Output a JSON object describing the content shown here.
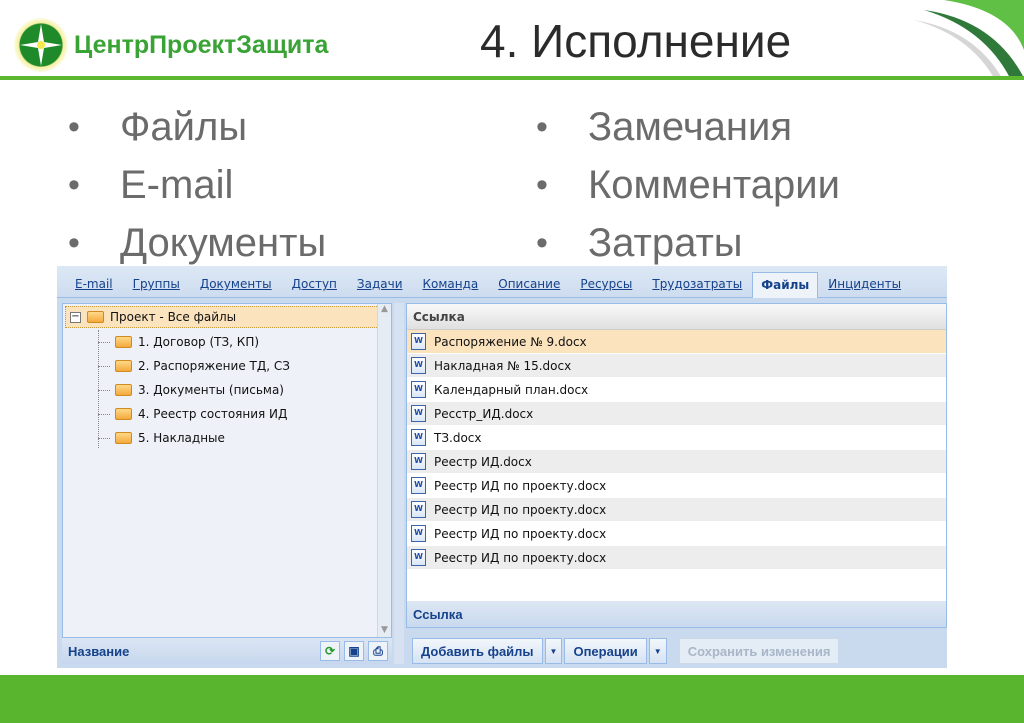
{
  "logo": {
    "text": "ЦентрПроектЗащита"
  },
  "title": "4. Исполнение",
  "bullets_left": [
    "Файлы",
    "E-mail",
    "Документы"
  ],
  "bullets_right": [
    "Замечания",
    "Комментарии",
    "Затраты"
  ],
  "bullet_char": "•",
  "app": {
    "tabs": [
      "E-mail",
      "Группы",
      "Документы",
      "Доступ",
      "Задачи",
      "Команда",
      "Описание",
      "Ресурсы",
      "Трудозатраты",
      "Файлы",
      "Инциденты"
    ],
    "active_tab": "Файлы",
    "tree": {
      "root": "Проект - Все файлы",
      "children": [
        "1. Договор (ТЗ, КП)",
        "2. Распоряжение ТД, СЗ",
        "3. Документы (письма)",
        "4. Реестр состояния ИД",
        "5. Накладные"
      ]
    },
    "left_footer": "Название",
    "grid_header": "Ссылка",
    "files": [
      "Распоряжение № 9.docx",
      "Накладная № 15.docx",
      "Календарный план.docx",
      "Ресстр_ИД.docx",
      "ТЗ.docx",
      "Реестр ИД.docx",
      "Реестр ИД по проекту.docx",
      "Реестр ИД по проекту.docx",
      "Реестр ИД по проекту.docx",
      "Реестр ИД по проекту.docx"
    ],
    "grid_footer": "Ссылка",
    "buttons": {
      "add": "Добавить файлы",
      "ops": "Операции",
      "save": "Сохранить изменения"
    }
  },
  "colors": {
    "brand_green": "#5ab52e",
    "selection": "#fbe3be",
    "link": "#15428b"
  }
}
